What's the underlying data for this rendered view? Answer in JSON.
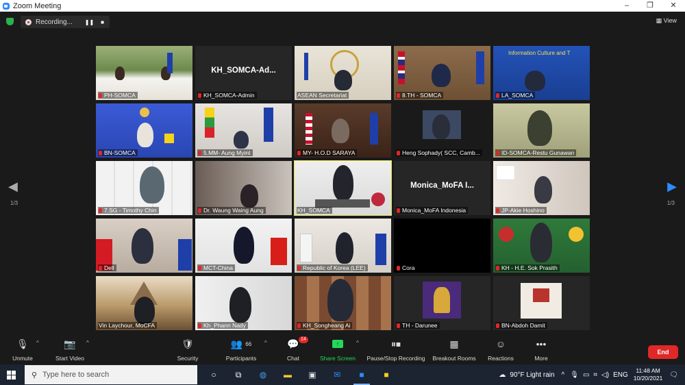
{
  "window": {
    "title": "Zoom Meeting",
    "controls": [
      "–",
      "❐",
      "✕"
    ]
  },
  "topbar": {
    "recording_label": "Recording...",
    "pause_icon": "❚❚",
    "stop_icon": "■",
    "view_label": "View"
  },
  "pagination": {
    "left": "1/3",
    "right": "1/3"
  },
  "participants": [
    {
      "name": "PH-SOMCA",
      "muted": true
    },
    {
      "name": "KH_SOMCA-Admin",
      "muted": true,
      "big": "KH_SOMCA-Ad..."
    },
    {
      "name": "ASEAN Secretariat",
      "muted": false
    },
    {
      "name": "8.TH - SOMCA",
      "muted": true
    },
    {
      "name": "LA_SOMCA",
      "muted": true,
      "sign": "Information Culture and T"
    },
    {
      "name": "BN-SOMCA",
      "muted": true
    },
    {
      "name": "5.MM- Aung Myint",
      "muted": true
    },
    {
      "name": "MY- H.O.D SARAYA",
      "muted": true
    },
    {
      "name": "Heng Sophady( SCC, Camb...",
      "muted": true
    },
    {
      "name": "ID-SOMCA-Restu Gunawan",
      "muted": true
    },
    {
      "name": "7.SG - Timothy Chin",
      "muted": true
    },
    {
      "name": "Dr. Waung Waing Aung",
      "muted": true
    },
    {
      "name": "KH_SOMCA",
      "muted": false
    },
    {
      "name": "Monica_MoFA Indonesia",
      "muted": true,
      "big": "Monica_MoFA I..."
    },
    {
      "name": "JP-Akie Hoshino",
      "muted": true
    },
    {
      "name": "Dell",
      "muted": true
    },
    {
      "name": "MCT-China",
      "muted": true
    },
    {
      "name": "Republic of Korea (LEE)",
      "muted": true
    },
    {
      "name": "Cora",
      "muted": true
    },
    {
      "name": "KH - H.E. Sok Prasith",
      "muted": true
    },
    {
      "name": "Vin Laychour, MoCFA",
      "muted": false
    },
    {
      "name": "Kh_Phann Nady",
      "muted": true
    },
    {
      "name": "KH_Songheang Ai",
      "muted": true
    },
    {
      "name": "TH - Darunee",
      "muted": true
    },
    {
      "name": "BN-Abdoh Damit",
      "muted": true
    }
  ],
  "toolbar": {
    "unmute": "Unmute",
    "start_video": "Start Video",
    "security": "Security",
    "participants": "Participants",
    "participants_count": "66",
    "chat": "Chat",
    "chat_badge": "14",
    "share_screen": "Share Screen",
    "recording": "Pause/Stop Recording",
    "breakout": "Breakout Rooms",
    "reactions": "Reactions",
    "more": "More",
    "end": "End"
  },
  "taskbar": {
    "search_placeholder": "Type here to search",
    "weather": "90°F  Light rain",
    "language": "ENG",
    "time": "11:48 AM",
    "date": "10/20/2021"
  },
  "colors": {
    "accent": "#2d8cff",
    "end_red": "#e02828",
    "active_speaker": "#e8e34a",
    "share_green": "#23d959"
  }
}
